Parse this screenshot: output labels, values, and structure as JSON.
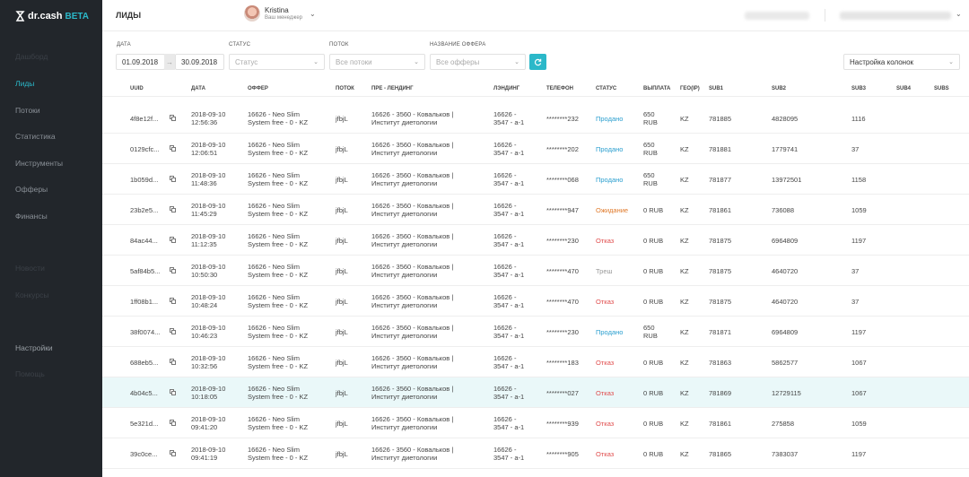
{
  "app": {
    "logo_text": "dr.cash",
    "logo_badge": "BETA",
    "accent_color": "#2bb8c9",
    "sidebar_color": "#22262b"
  },
  "sidebar": {
    "items": [
      {
        "label": "Лиды",
        "active": true
      },
      {
        "label": "Потоки"
      },
      {
        "label": "Статистика"
      },
      {
        "label": "Инструменты"
      },
      {
        "label": "Офферы"
      },
      {
        "label": "Финансы"
      },
      {
        "label": "Настройки"
      }
    ]
  },
  "header": {
    "title": "ЛИДЫ",
    "user_name": "Kristina",
    "user_role": "Ваш менеджер",
    "chevron_icon": "chevron-down-icon"
  },
  "filters": {
    "date_label": "ДАТА",
    "date_from": "01.09.2018",
    "date_to": "30.09.2018",
    "status_label": "СТАТУС",
    "status_placeholder": "Статус",
    "flow_label": "ПОТОК",
    "flow_placeholder": "Все потоки",
    "offer_label": "НАЗВАНИЕ ОФФЕРА",
    "offer_placeholder": "Все офферы",
    "columns_label": "Настройка колонок",
    "refresh_icon": "refresh-icon"
  },
  "table": {
    "columns": [
      "UUID",
      "ДАТА",
      "ОФФЕР",
      "ПОТОК",
      "ПРЕ - ЛЕНДИНГ",
      "ЛЭНДИНГ",
      "ТЕЛЕФОН",
      "СТАТУС",
      "ВЫПЛАТА",
      "ГЕО(IP)",
      "SUB1",
      "SUB2",
      "SUB3",
      "SUB4",
      "SUBS"
    ],
    "rows": [
      {
        "uuid": "4f8e12f...",
        "date": "2018-09-10",
        "time": "12:56:36",
        "offer1": "16626 - Neo Slim",
        "offer2": "System free - 0 - KZ",
        "flow": "jfbjL",
        "pre1": "16626 - 3560 - Ковальков |",
        "pre2": "Институт диетологии",
        "land1": "16626 -",
        "land2": "3547 - a-1",
        "phone": "********232",
        "status": "Продано",
        "status_type": "sold",
        "pay1": "650",
        "pay2": "RUB",
        "geo": "KZ",
        "sub1": "781885",
        "sub2": "4828095",
        "sub3": "1116"
      },
      {
        "uuid": "0129cfc...",
        "date": "2018-09-10",
        "time": "12:06:51",
        "offer1": "16626 - Neo Slim",
        "offer2": "System free - 0 - KZ",
        "flow": "jfbjL",
        "pre1": "16626 - 3560 - Ковальков |",
        "pre2": "Институт диетологии",
        "land1": "16626 -",
        "land2": "3547 - a-1",
        "phone": "********202",
        "status": "Продано",
        "status_type": "sold",
        "pay1": "650",
        "pay2": "RUB",
        "geo": "KZ",
        "sub1": "781881",
        "sub2": "1779741",
        "sub3": "37"
      },
      {
        "uuid": "1b059d...",
        "date": "2018-09-10",
        "time": "11:48:36",
        "offer1": "16626 - Neo Slim",
        "offer2": "System free - 0 - KZ",
        "flow": "jfbjL",
        "pre1": "16626 - 3560 - Ковальков |",
        "pre2": "Институт диетологии",
        "land1": "16626 -",
        "land2": "3547 - a-1",
        "phone": "********068",
        "status": "Продано",
        "status_type": "sold",
        "pay1": "650",
        "pay2": "RUB",
        "geo": "KZ",
        "sub1": "781877",
        "sub2": "13972501",
        "sub3": "1158"
      },
      {
        "uuid": "23b2e5...",
        "date": "2018-09-10",
        "time": "11:45:29",
        "offer1": "16626 - Neo Slim",
        "offer2": "System free - 0 - KZ",
        "flow": "jfbjL",
        "pre1": "16626 - 3560 - Ковальков |",
        "pre2": "Институт диетологии",
        "land1": "16626 -",
        "land2": "3547 - a-1",
        "phone": "********947",
        "status": "Ожидание",
        "status_type": "wait",
        "pay1": "0 RUB",
        "pay2": "",
        "geo": "KZ",
        "sub1": "781861",
        "sub2": "736088",
        "sub3": "1059"
      },
      {
        "uuid": "84ac44...",
        "date": "2018-09-10",
        "time": "11:12:35",
        "offer1": "16626 - Neo Slim",
        "offer2": "System free - 0 - KZ",
        "flow": "jfbjL",
        "pre1": "16626 - 3560 - Ковальков |",
        "pre2": "Институт диетологии",
        "land1": "16626 -",
        "land2": "3547 - a-1",
        "phone": "********230",
        "status": "Отказ",
        "status_type": "reject",
        "pay1": "0 RUB",
        "pay2": "",
        "geo": "KZ",
        "sub1": "781875",
        "sub2": "6964809",
        "sub3": "1197"
      },
      {
        "uuid": "5af84b5...",
        "date": "2018-09-10",
        "time": "10:50:30",
        "offer1": "16626 - Neo Slim",
        "offer2": "System free - 0 - KZ",
        "flow": "jfbjL",
        "pre1": "16626 - 3560 - Ковальков |",
        "pre2": "Институт диетологии",
        "land1": "16626 -",
        "land2": "3547 - a-1",
        "phone": "********470",
        "status": "Треш",
        "status_type": "trash",
        "pay1": "0 RUB",
        "pay2": "",
        "geo": "KZ",
        "sub1": "781875",
        "sub2": "4640720",
        "sub3": "37"
      },
      {
        "uuid": "1ff08b1...",
        "date": "2018-09-10",
        "time": "10:48:24",
        "offer1": "16626 - Neo Slim",
        "offer2": "System free - 0 - KZ",
        "flow": "jfbjL",
        "pre1": "16626 - 3560 - Ковальков |",
        "pre2": "Институт диетологии",
        "land1": "16626 -",
        "land2": "3547 - a-1",
        "phone": "********470",
        "status": "Отказ",
        "status_type": "reject",
        "pay1": "0 RUB",
        "pay2": "",
        "geo": "KZ",
        "sub1": "781875",
        "sub2": "4640720",
        "sub3": "37"
      },
      {
        "uuid": "38f0074...",
        "date": "2018-09-10",
        "time": "10:46:23",
        "offer1": "16626 - Neo Slim",
        "offer2": "System free - 0 - KZ",
        "flow": "jfbjL",
        "pre1": "16626 - 3560 - Ковальков |",
        "pre2": "Институт диетологии",
        "land1": "16626 -",
        "land2": "3547 - a-1",
        "phone": "********230",
        "status": "Продано",
        "status_type": "sold",
        "pay1": "650",
        "pay2": "RUB",
        "geo": "KZ",
        "sub1": "781871",
        "sub2": "6964809",
        "sub3": "1197"
      },
      {
        "uuid": "688eb5...",
        "date": "2018-09-10",
        "time": "10:32:56",
        "offer1": "16626 - Neo Slim",
        "offer2": "System free - 0 - KZ",
        "flow": "jfbjL",
        "pre1": "16626 - 3560 - Ковальков |",
        "pre2": "Институт диетологии",
        "land1": "16626 -",
        "land2": "3547 - a-1",
        "phone": "********183",
        "status": "Отказ",
        "status_type": "reject",
        "pay1": "0 RUB",
        "pay2": "",
        "geo": "KZ",
        "sub1": "781863",
        "sub2": "5862577",
        "sub3": "1067"
      },
      {
        "uuid": "4b04c5...",
        "date": "2018-09-10",
        "time": "10:18:05",
        "offer1": "16626 - Neo Slim",
        "offer2": "System free - 0 - KZ",
        "flow": "jfbjL",
        "pre1": "16626 - 3560 - Ковальков |",
        "pre2": "Институт диетологии",
        "land1": "16626 -",
        "land2": "3547 - a-1",
        "phone": "********027",
        "status": "Отказ",
        "status_type": "reject",
        "pay1": "0 RUB",
        "pay2": "",
        "geo": "KZ",
        "sub1": "781869",
        "sub2": "12729115",
        "sub3": "1067",
        "highlight": true
      },
      {
        "uuid": "5e321d...",
        "date": "2018-09-10",
        "time": "09:41:20",
        "offer1": "16626 - Neo Slim",
        "offer2": "System free - 0 - KZ",
        "flow": "jfbjL",
        "pre1": "16626 - 3560 - Ковальков |",
        "pre2": "Институт диетологии",
        "land1": "16626 -",
        "land2": "3547 - a-1",
        "phone": "********939",
        "status": "Отказ",
        "status_type": "reject",
        "pay1": "0 RUB",
        "pay2": "",
        "geo": "KZ",
        "sub1": "781861",
        "sub2": "275858",
        "sub3": "1059"
      },
      {
        "uuid": "39c0ce...",
        "date": "2018-09-10",
        "time": "09:41:19",
        "offer1": "16626 - Neo Slim",
        "offer2": "System free - 0 - KZ",
        "flow": "jfbjL",
        "pre1": "16626 - 3560 - Ковальков |",
        "pre2": "Институт диетологии",
        "land1": "16626 -",
        "land2": "3547 - a-1",
        "phone": "********905",
        "status": "Отказ",
        "status_type": "reject",
        "pay1": "0 RUB",
        "pay2": "",
        "geo": "KZ",
        "sub1": "781865",
        "sub2": "7383037",
        "sub3": "1197"
      }
    ]
  }
}
